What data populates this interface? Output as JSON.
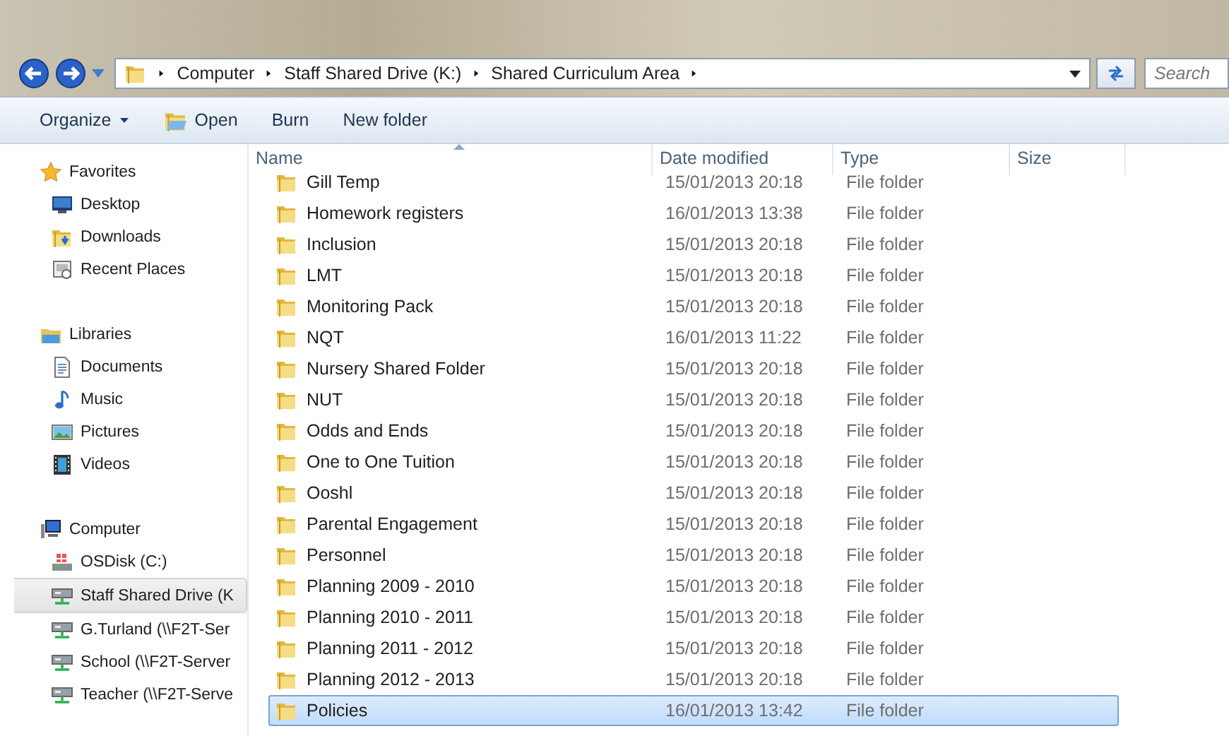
{
  "address_bar": {
    "crumbs": [
      "Computer",
      "Staff Shared Drive (K:)",
      "Shared Curriculum Area"
    ]
  },
  "search": {
    "placeholder": "Search"
  },
  "toolbar": [
    {
      "label": "Organize",
      "kind": "menu"
    },
    {
      "label": "Open",
      "kind": "open"
    },
    {
      "label": "Burn",
      "kind": "plain"
    },
    {
      "label": "New folder",
      "kind": "plain"
    }
  ],
  "sidebar": {
    "groups": [
      {
        "label": "Favorites",
        "kind": "star",
        "children": [
          {
            "label": "Desktop",
            "kind": "desktop",
            "selected": false
          },
          {
            "label": "Downloads",
            "kind": "downloads",
            "selected": false
          },
          {
            "label": "Recent Places",
            "kind": "recent",
            "selected": false
          }
        ]
      },
      {
        "label": "Libraries",
        "kind": "library",
        "children": [
          {
            "label": "Documents",
            "kind": "document",
            "selected": false
          },
          {
            "label": "Music",
            "kind": "music",
            "selected": false
          },
          {
            "label": "Pictures",
            "kind": "pictures",
            "selected": false
          },
          {
            "label": "Videos",
            "kind": "video",
            "selected": false
          }
        ]
      },
      {
        "label": "Computer",
        "kind": "computer",
        "children": [
          {
            "label": "OSDisk (C:)",
            "kind": "disk",
            "selected": false
          },
          {
            "label": "Staff Shared Drive (K",
            "kind": "network",
            "selected": true
          },
          {
            "label": "G.Turland (\\\\F2T-Ser",
            "kind": "network",
            "selected": false
          },
          {
            "label": "School (\\\\F2T-Server",
            "kind": "network",
            "selected": false
          },
          {
            "label": "Teacher (\\\\F2T-Serve",
            "kind": "network",
            "selected": false
          }
        ]
      }
    ]
  },
  "table": {
    "columns": [
      "Name",
      "Date modified",
      "Type",
      "Size"
    ],
    "rows": [
      {
        "name": "Gill Temp",
        "date": "15/01/2013 20:18",
        "type": "File folder",
        "selected": false
      },
      {
        "name": "Homework registers",
        "date": "16/01/2013 13:38",
        "type": "File folder",
        "selected": false
      },
      {
        "name": "Inclusion",
        "date": "15/01/2013 20:18",
        "type": "File folder",
        "selected": false
      },
      {
        "name": "LMT",
        "date": "15/01/2013 20:18",
        "type": "File folder",
        "selected": false
      },
      {
        "name": "Monitoring Pack",
        "date": "15/01/2013 20:18",
        "type": "File folder",
        "selected": false
      },
      {
        "name": "NQT",
        "date": "16/01/2013 11:22",
        "type": "File folder",
        "selected": false
      },
      {
        "name": "Nursery Shared Folder",
        "date": "15/01/2013 20:18",
        "type": "File folder",
        "selected": false
      },
      {
        "name": "NUT",
        "date": "15/01/2013 20:18",
        "type": "File folder",
        "selected": false
      },
      {
        "name": "Odds and Ends",
        "date": "15/01/2013 20:18",
        "type": "File folder",
        "selected": false
      },
      {
        "name": "One to One Tuition",
        "date": "15/01/2013 20:18",
        "type": "File folder",
        "selected": false
      },
      {
        "name": "Ooshl",
        "date": "15/01/2013 20:18",
        "type": "File folder",
        "selected": false
      },
      {
        "name": "Parental Engagement",
        "date": "15/01/2013 20:18",
        "type": "File folder",
        "selected": false
      },
      {
        "name": "Personnel",
        "date": "15/01/2013 20:18",
        "type": "File folder",
        "selected": false
      },
      {
        "name": "Planning 2009 - 2010",
        "date": "15/01/2013 20:18",
        "type": "File folder",
        "selected": false
      },
      {
        "name": "Planning 2010 - 2011",
        "date": "15/01/2013 20:18",
        "type": "File folder",
        "selected": false
      },
      {
        "name": "Planning 2011 - 2012",
        "date": "15/01/2013 20:18",
        "type": "File folder",
        "selected": false
      },
      {
        "name": "Planning 2012 - 2013",
        "date": "15/01/2013 20:18",
        "type": "File folder",
        "selected": false
      },
      {
        "name": "Policies",
        "date": "16/01/2013 13:42",
        "type": "File folder",
        "selected": true
      }
    ]
  }
}
